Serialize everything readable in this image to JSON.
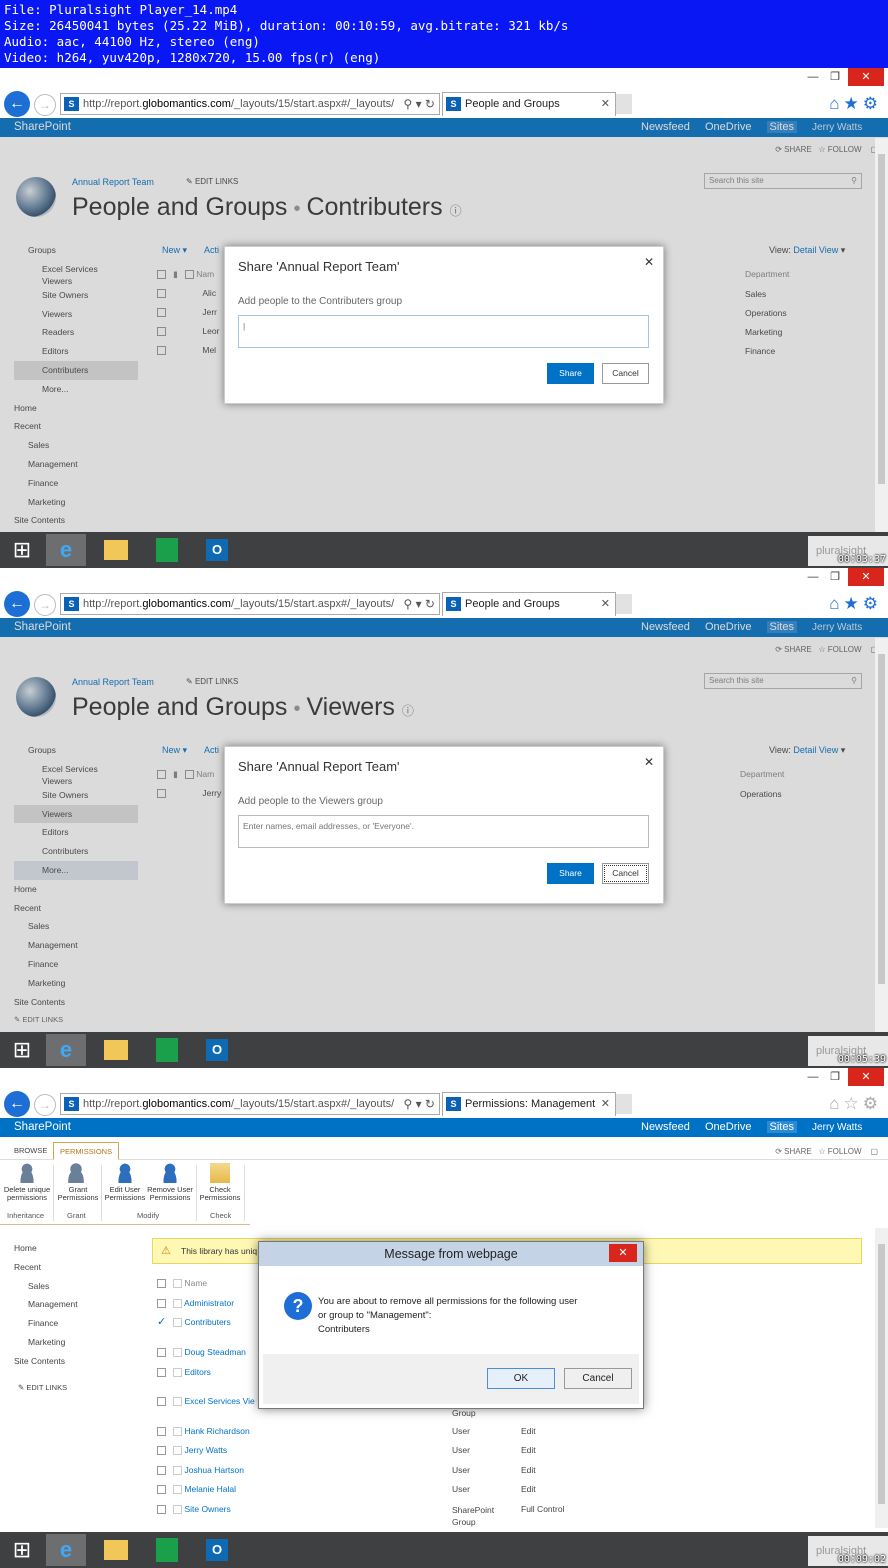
{
  "banner": {
    "line1": "File: Pluralsight Player_14.mp4",
    "line2": "Size: 26450041 bytes (25.22 MiB), duration: 00:10:59, avg.bitrate: 321 kb/s",
    "line3": "Audio: aac, 44100 Hz, stereo (eng)",
    "line4": "Video: h264, yuv420p, 1280x720, 15.00 fps(r) (eng)"
  },
  "browser": {
    "url_prefix": "http://report.",
    "url_domain": "globomantics.com",
    "url_suffix": "/_layouts/15/start.aspx#/_layouts/",
    "tab1_title": "People and Groups",
    "tab3_title": "Permissions: Management"
  },
  "suitebar": {
    "brand": "SharePoint",
    "newsfeed": "Newsfeed",
    "onedrive": "OneDrive",
    "sites": "Sites",
    "user": "Jerry Watts",
    "share": "SHARE",
    "follow": "FOLLOW"
  },
  "site": {
    "crumb": "Annual Report Team",
    "edit_links": "EDIT LINKS",
    "title_main": "People and Groups",
    "title_sub1": "Contributers",
    "title_sub2": "Viewers",
    "search_placeholder": "Search this site",
    "new_label": "New",
    "actions_label": "Acti",
    "view_label": "View:",
    "view_value": "Detail View"
  },
  "nav": {
    "groups": "Groups",
    "excel1": "Excel Services",
    "excel2": "Viewers",
    "site_owners": "Site Owners",
    "viewers": "Viewers",
    "readers": "Readers",
    "editors": "Editors",
    "contributers": "Contributers",
    "more": "More...",
    "home": "Home",
    "recent": "Recent",
    "sales": "Sales",
    "management": "Management",
    "finance": "Finance",
    "marketing": "Marketing",
    "site_contents": "Site Contents"
  },
  "frame1": {
    "col_name": "Nam",
    "col_dept": "Department",
    "rows": [
      {
        "name": "Alic",
        "dept": "Sales"
      },
      {
        "name": "Jerr",
        "dept": "Operations"
      },
      {
        "name": "Leor",
        "dept": "Marketing"
      },
      {
        "name": "Mel",
        "dept": "Finance"
      }
    ],
    "dialog_title": "Share 'Annual Report Team'",
    "dialog_sub": "Add people to the Contributers group",
    "share_btn": "Share",
    "cancel_btn": "Cancel",
    "timestamp": "00:03:37"
  },
  "frame2": {
    "col_name": "Nam",
    "col_dept": "Department",
    "rows": [
      {
        "name": "Jerry",
        "dept": "Operations"
      }
    ],
    "dialog_title": "Share 'Annual Report Team'",
    "dialog_sub": "Add people to the Viewers group",
    "input_placeholder": "Enter names, email addresses, or 'Everyone'.",
    "share_btn": "Share",
    "cancel_btn": "Cancel",
    "edit_links": "EDIT LINKS",
    "timestamp": "00:05:39"
  },
  "frame3": {
    "ribbon_tabs": [
      "BROWSE",
      "PERMISSIONS"
    ],
    "ribbon_buttons": [
      {
        "label1": "Delete unique",
        "label2": "permissions"
      },
      {
        "label1": "Grant",
        "label2": "Permissions"
      },
      {
        "label1": "Edit User",
        "label2": "Permissions"
      },
      {
        "label1": "Remove User",
        "label2": "Permissions"
      },
      {
        "label1": "Check",
        "label2": "Permissions"
      }
    ],
    "ribbon_groups": [
      "Inheritance",
      "Grant",
      "Modify",
      "Check"
    ],
    "nav": {
      "home": "Home",
      "recent": "Recent",
      "sales": "Sales",
      "management": "Management",
      "finance": "Finance",
      "marketing": "Marketing",
      "site_contents": "Site Contents",
      "edit_links": "EDIT LINKS"
    },
    "warning": "This library has uniq",
    "col_name": "Name",
    "rows": [
      {
        "name": "Administrator",
        "type": "",
        "perm": ""
      },
      {
        "name": "Contributers",
        "type": "",
        "perm": ""
      },
      {
        "name": "Doug Steadman",
        "type": "",
        "perm": ""
      },
      {
        "name": "Editors",
        "type": "",
        "perm": ""
      },
      {
        "name": "Excel Services Vie",
        "type": "Group",
        "perm": ""
      },
      {
        "name": "Hank Richardson",
        "type": "User",
        "perm": "Edit"
      },
      {
        "name": "Jerry Watts",
        "type": "User",
        "perm": "Edit"
      },
      {
        "name": "Joshua Hartson",
        "type": "User",
        "perm": "Edit"
      },
      {
        "name": "Melanie Halal",
        "type": "User",
        "perm": "Edit"
      },
      {
        "name": "Site Owners",
        "type": "SharePoint",
        "type2": "Group",
        "perm": "Full Control"
      }
    ],
    "msg_title": "Message from webpage",
    "msg_line1": "You are about to remove all permissions for the following user",
    "msg_line2": "or group to \"Management\":",
    "msg_line3": "Contributers",
    "ok_btn": "OK",
    "cancel_btn": "Cancel",
    "timestamp": "00:09:02"
  },
  "taskbar": {
    "watermark": "pluralsight"
  },
  "colors": {
    "banner": "#0a17f5",
    "suitebar": "#0072c6",
    "close": "#d9261c",
    "taskbar": "#3f4042"
  }
}
